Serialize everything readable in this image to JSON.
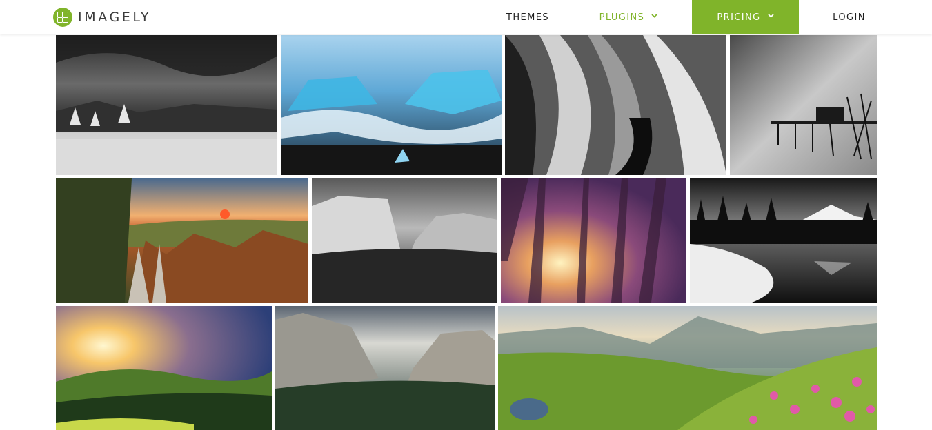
{
  "brand": {
    "name": "IMAGELY",
    "accent_color": "#80b42a",
    "logo_icon": "imagely-logo-icon"
  },
  "nav": {
    "themes": "THEMES",
    "plugins": "PLUGINS",
    "pricing": "PRICING",
    "login": "LOGIN",
    "dropdown_icon": "chevron-down-icon"
  },
  "gallery": {
    "photos": [
      {
        "subject": "black-and-white field under stormy clouds"
      },
      {
        "subject": "blue ice chunks on black sand beach"
      },
      {
        "subject": "black-and-white slot canyon"
      },
      {
        "subject": "black-and-white long exposure pier"
      },
      {
        "subject": "autumn mountain ridge at sunset"
      },
      {
        "subject": "black-and-white valley cliffs"
      },
      {
        "subject": "purple sun through tall trees"
      },
      {
        "subject": "black-and-white snowy lake and mountain"
      },
      {
        "subject": "sunburst over green hills"
      },
      {
        "subject": "cloudy valley with granite cliffs"
      },
      {
        "subject": "mountain meadow with pink flowers"
      }
    ]
  }
}
